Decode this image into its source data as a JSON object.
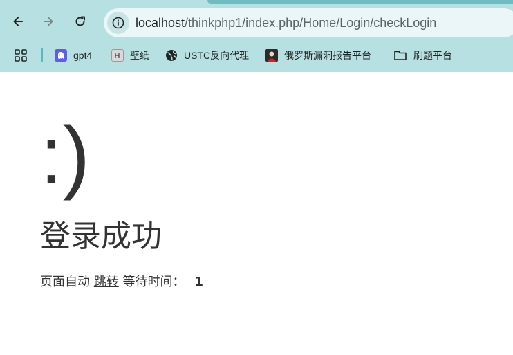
{
  "browser": {
    "url_host": "localhost",
    "url_path": "/thinkphp1/index.php/Home/Login/checkLogin",
    "bookmarks": [
      {
        "label": "gpt4",
        "icon": "ghost-icon"
      },
      {
        "label": "壁纸",
        "icon": "wallpaper-icon"
      },
      {
        "label": "USTC反向代理",
        "icon": "globe-icon"
      },
      {
        "label": "俄罗斯漏洞报告平台",
        "icon": "site-avatar-icon"
      },
      {
        "label": "刷题平台",
        "icon": "folder-icon"
      }
    ],
    "colors": {
      "chrome_bg": "#b7e0e3",
      "omnibox_bg": "#eaf6f7",
      "accent": "#5bb6bd"
    }
  },
  "page": {
    "face": ":)",
    "message": "登录成功",
    "jump_prefix": "页面自动",
    "jump_link": "跳转",
    "wait_label": "等待时间：",
    "wait_seconds": "1"
  }
}
